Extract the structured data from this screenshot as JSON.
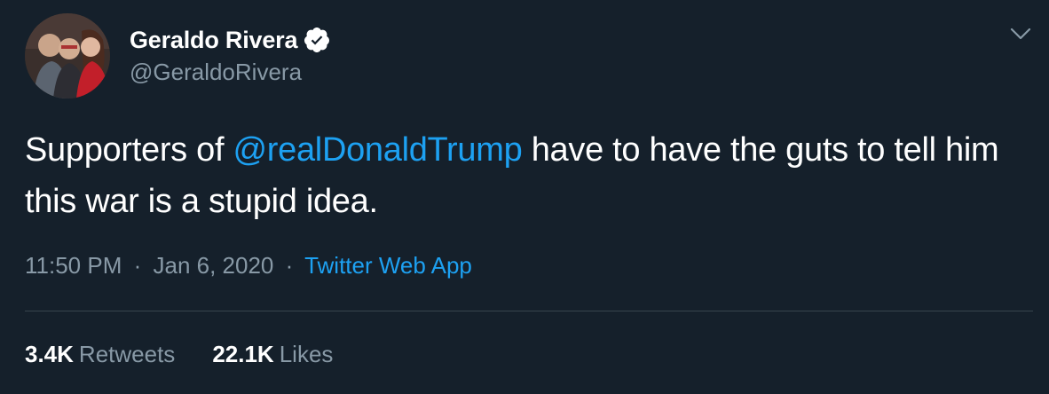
{
  "author": {
    "display_name": "Geraldo Rivera",
    "handle": "@GeraldoRivera",
    "verified": true,
    "avatar_icon": "profile-photo"
  },
  "tweet": {
    "text_before": "Supporters of ",
    "mention": "@realDonaldTrump",
    "text_after": " have to have the guts to tell him this war is a stupid idea."
  },
  "meta": {
    "time": "11:50 PM",
    "separator": "·",
    "date": "Jan 6, 2020",
    "source": "Twitter Web App"
  },
  "stats": {
    "retweets_count": "3.4K",
    "retweets_label": "Retweets",
    "likes_count": "22.1K",
    "likes_label": "Likes"
  },
  "colors": {
    "background": "#15202b",
    "link": "#1da1f2",
    "secondary_text": "#8899a6",
    "divider": "#38444d"
  },
  "icons": {
    "verified": "verified-badge-icon",
    "more": "chevron-down-icon"
  }
}
